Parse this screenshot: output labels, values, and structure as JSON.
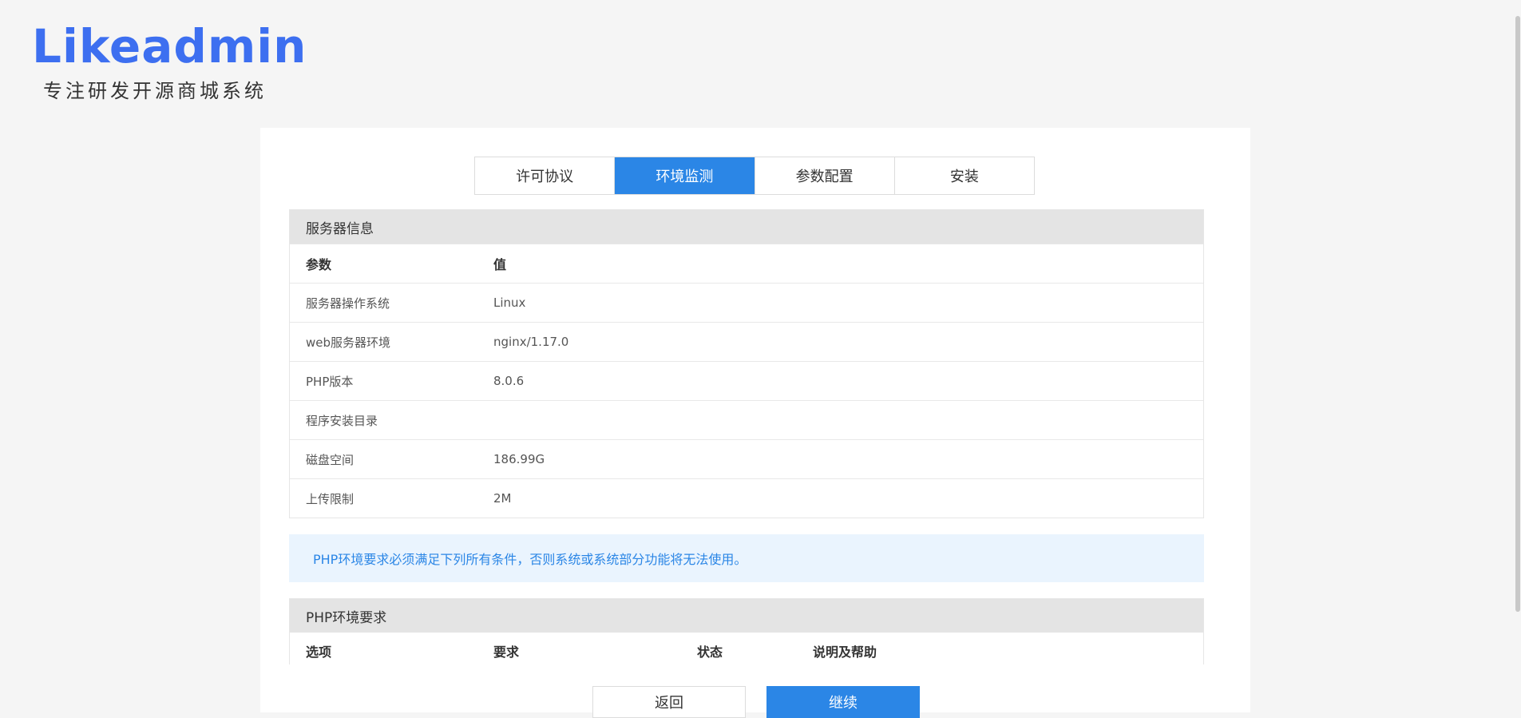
{
  "logo": {
    "word": "Likeadmin",
    "tagline": "专注研发开源商城系统"
  },
  "tabs": [
    {
      "label": "许可协议",
      "active": false
    },
    {
      "label": "环境监测",
      "active": true
    },
    {
      "label": "参数配置",
      "active": false
    },
    {
      "label": "安装",
      "active": false
    }
  ],
  "server_info": {
    "title": "服务器信息",
    "header": {
      "param": "参数",
      "value": "值"
    },
    "rows": [
      {
        "param": "服务器操作系统",
        "value": "Linux"
      },
      {
        "param": "web服务器环境",
        "value": "nginx/1.17.0"
      },
      {
        "param": "PHP版本",
        "value": "8.0.6"
      },
      {
        "param": "程序安装目录",
        "value": ""
      },
      {
        "param": "磁盘空间",
        "value": "186.99G"
      },
      {
        "param": "上传限制",
        "value": "2M"
      }
    ]
  },
  "notice": "PHP环境要求必须满足下列所有条件，否则系统或系统部分功能将无法使用。",
  "php_req": {
    "title": "PHP环境要求",
    "columns": [
      "选项",
      "要求",
      "状态",
      "说明及帮助"
    ]
  },
  "buttons": {
    "back": "返回",
    "next": "继续"
  },
  "colors": {
    "accent": "#2b86e6",
    "logo": "#3d6ff0",
    "notice_bg": "#eaf4fe"
  }
}
